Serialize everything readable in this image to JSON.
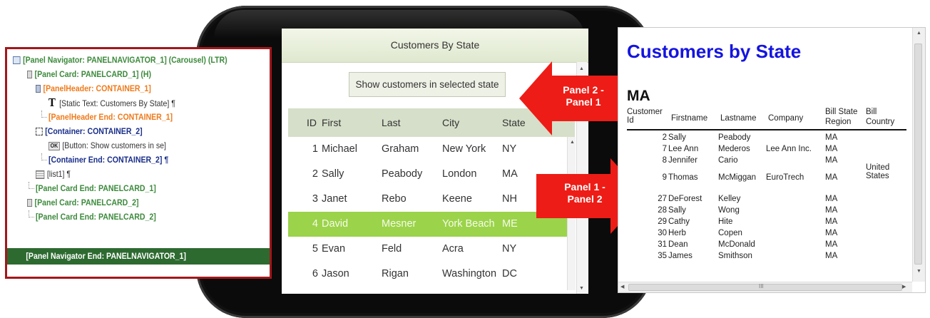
{
  "tree": {
    "rows": [
      {
        "text": "[Panel Navigator: PANELNAVIGATOR_1] (Carousel) (LTR)",
        "color": "#3c8a3c",
        "icon": "panel-navigator-icon"
      },
      {
        "text": "[Panel Card: PANELCARD_1]  (H)",
        "color": "#3c8a3c",
        "icon": "panel-card-icon"
      },
      {
        "text": "[PanelHeader: CONTAINER_1]",
        "color": "#f07a1a",
        "icon": "panel-header-icon"
      },
      {
        "text": "[Static Text: Customers By State] ¶",
        "color": "#333333",
        "icon": "static-text-icon"
      },
      {
        "text": "[PanelHeader End: CONTAINER_1]",
        "color": "#f07a1a",
        "icon": ""
      },
      {
        "text": "[Container: CONTAINER_2]",
        "color": "#1a2f8a",
        "icon": "container-icon"
      },
      {
        "text": "[Button: Show customers in se]",
        "color": "#333333",
        "icon": "button-icon",
        "icon_text": "OK"
      },
      {
        "text": "[Container End: CONTAINER_2] ¶",
        "color": "#1a2f8a",
        "icon": ""
      },
      {
        "text": "[list1] ¶",
        "color": "#333333",
        "icon": "list-icon"
      },
      {
        "text": "[Panel Card End: PANELCARD_1]",
        "color": "#3c8a3c",
        "icon": ""
      },
      {
        "text": "[Panel Card: PANELCARD_2]",
        "color": "#3c8a3c",
        "icon": "panel-card-icon"
      },
      {
        "text": "[Panel Card End: PANELCARD_2]",
        "color": "#3c8a3c",
        "icon": ""
      }
    ],
    "end_row": "[Panel Navigator End: PANELNAVIGATOR_1]"
  },
  "app": {
    "header_title": "Customers By State",
    "show_button": "Show customers in selected state",
    "columns": [
      "ID",
      "First",
      "Last",
      "City",
      "State"
    ],
    "rows": [
      {
        "id": "1",
        "first": "Michael",
        "last": "Graham",
        "city": "New York",
        "state": "NY",
        "selected": false
      },
      {
        "id": "2",
        "first": "Sally",
        "last": "Peabody",
        "city": "London",
        "state": "MA",
        "selected": false
      },
      {
        "id": "3",
        "first": "Janet",
        "last": "Rebo",
        "city": "Keene",
        "state": "NH",
        "selected": false
      },
      {
        "id": "4",
        "first": "David",
        "last": "Mesner",
        "city": "York Beach",
        "state": "ME",
        "selected": true
      },
      {
        "id": "5",
        "first": "Evan",
        "last": "Feld",
        "city": "Acra",
        "state": "NY",
        "selected": false
      },
      {
        "id": "6",
        "first": "Jason",
        "last": "Rigan",
        "city": "Washington",
        "state": "DC",
        "selected": false
      }
    ]
  },
  "arrows": {
    "upper": "Panel 2 -\nPanel 1",
    "lower": "Panel 1 -\nPanel 2"
  },
  "report": {
    "title": "Customers by State",
    "state": "MA",
    "headers": {
      "customer_id_1": "Customer",
      "customer_id_2": "Id",
      "firstname": "Firstname",
      "lastname": "Lastname",
      "company": "Company",
      "bill_state_1": "Bill State",
      "bill_state_2": "Region",
      "bill_country_1": "Bill",
      "bill_country_2": "Country"
    },
    "rows": [
      {
        "id": "2",
        "first": "Sally",
        "last": "Peabody",
        "company": "",
        "state": "MA",
        "country": ""
      },
      {
        "id": "7",
        "first": "Lee Ann",
        "last": "Mederos",
        "company": "Lee Ann Inc.",
        "state": "MA",
        "country": ""
      },
      {
        "id": "8",
        "first": "Jennifer",
        "last": "Cario",
        "company": "",
        "state": "MA",
        "country": ""
      },
      {
        "id": "9",
        "first": "Thomas",
        "last": "McMiggan",
        "company": "EuroTrech",
        "state": "MA",
        "country": "United\nStates"
      },
      {
        "id": "27",
        "first": "DeForest",
        "last": "Kelley",
        "company": "",
        "state": "MA",
        "country": ""
      },
      {
        "id": "28",
        "first": "Sally",
        "last": "Wong",
        "company": "",
        "state": "MA",
        "country": ""
      },
      {
        "id": "29",
        "first": "Cathy",
        "last": "Hite",
        "company": "",
        "state": "MA",
        "country": ""
      },
      {
        "id": "30",
        "first": "Herb",
        "last": "Copen",
        "company": "",
        "state": "MA",
        "country": ""
      },
      {
        "id": "31",
        "first": "Dean",
        "last": "McDonald",
        "company": "",
        "state": "MA",
        "country": ""
      },
      {
        "id": "35",
        "first": "James",
        "last": "Smithson",
        "company": "",
        "state": "MA",
        "country": ""
      }
    ],
    "hscroll_grip": "III"
  },
  "colors": {
    "tree_border": "#a3171b",
    "tree_end_bg": "#2d6a30",
    "selection_green": "#9bd34a",
    "report_title_blue": "#1414e0",
    "arrow_red": "#ee1c16"
  }
}
